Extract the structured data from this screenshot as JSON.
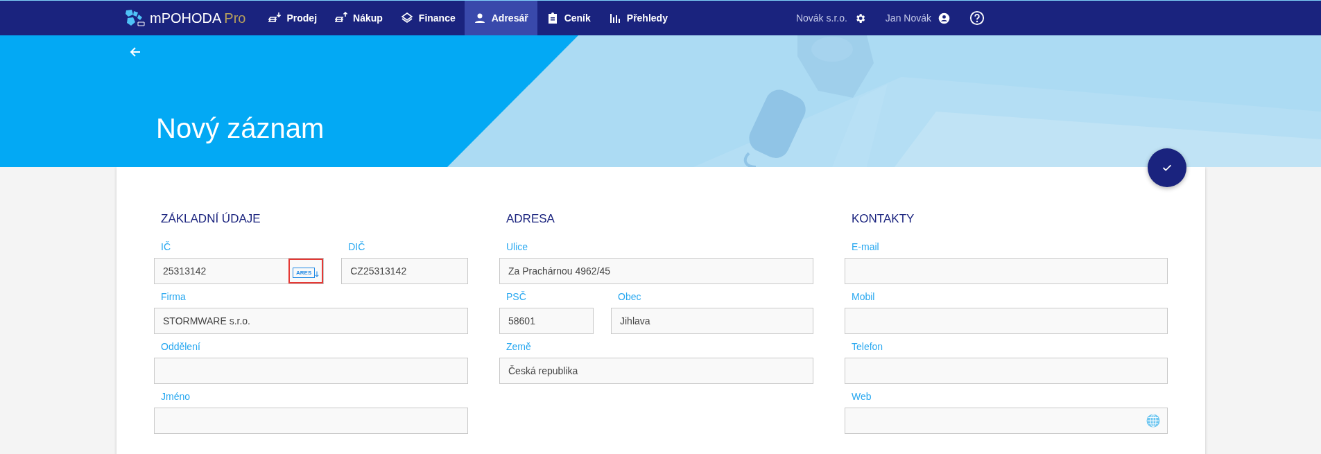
{
  "app": {
    "name": "mPOHODA",
    "edition": "Pro"
  },
  "nav": [
    {
      "label": "Prodej",
      "selected": false
    },
    {
      "label": "Nákup",
      "selected": false
    },
    {
      "label": "Finance",
      "selected": false
    },
    {
      "label": "Adresář",
      "selected": true
    },
    {
      "label": "Ceník",
      "selected": false
    },
    {
      "label": "Přehledy",
      "selected": false
    }
  ],
  "company": "Novák s.r.o.",
  "user": "Jan Novák",
  "header": {
    "title": "Nový záznam"
  },
  "sections": [
    {
      "title": "ZÁKLADNÍ ÚDAJE",
      "rows": [
        [
          {
            "label": "IČ",
            "value": "25313142",
            "kind": "ares",
            "action": "ARES",
            "highlighted": true
          },
          {
            "label": "DIČ",
            "value": "CZ25313142",
            "kind": "text"
          }
        ],
        [
          {
            "label": "Firma",
            "value": "STORMWARE s.r.o.",
            "kind": "text"
          }
        ],
        [
          {
            "label": "Oddělení",
            "kind": "text"
          }
        ],
        [
          {
            "label": "Jméno",
            "kind": "text"
          }
        ]
      ]
    },
    {
      "title": "ADRESA",
      "rows": [
        [
          {
            "label": "Ulice",
            "value": "Za Prachárnou 4962/45",
            "kind": "text"
          }
        ],
        [
          {
            "label": "PSČ",
            "value": "58601",
            "kind": "text"
          },
          {
            "label": "Obec",
            "value": "Jihlava",
            "kind": "text"
          }
        ],
        [
          {
            "label": "Země",
            "value": "Česká republika",
            "kind": "text"
          }
        ]
      ]
    },
    {
      "title": "KONTAKTY",
      "rows": [
        [
          {
            "label": "E-mail",
            "kind": "text"
          }
        ],
        [
          {
            "label": "Mobil",
            "kind": "text"
          }
        ],
        [
          {
            "label": "Telefon",
            "kind": "text"
          }
        ],
        [
          {
            "label": "Web",
            "kind": "web"
          }
        ]
      ]
    }
  ]
}
